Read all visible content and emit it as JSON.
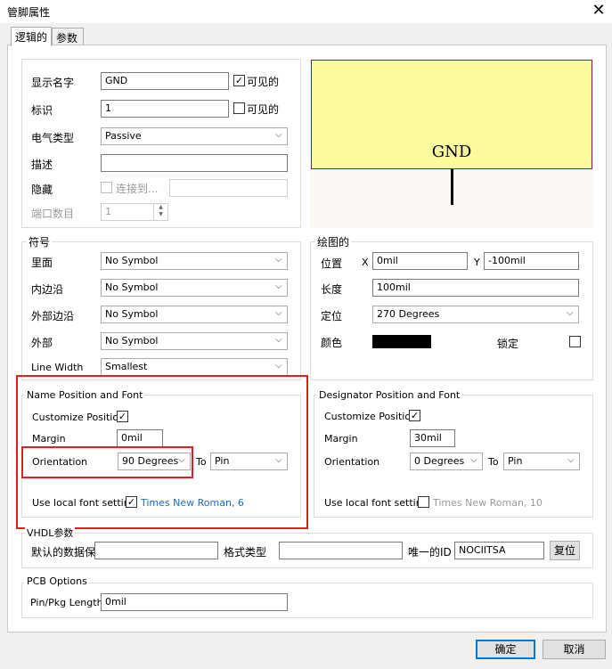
{
  "window": {
    "title": "管脚属性",
    "close_glyph": "✕"
  },
  "tabs": [
    {
      "label": "逻辑的"
    },
    {
      "label": "参数"
    }
  ],
  "basic": {
    "display_name_label": "显示名字",
    "display_name_value": "GND",
    "display_name_visible_label": "可见的",
    "designator_label": "标识",
    "designator_value": "1",
    "designator_visible_label": "可见的",
    "electrical_type_label": "电气类型",
    "electrical_type_value": "Passive",
    "description_label": "描述",
    "description_value": "",
    "hidden_label": "隐藏",
    "connect_to_label": "连接到...",
    "connect_to_value": "",
    "port_count_label": "端口数目",
    "port_count_value": "1"
  },
  "preview": {
    "pin_name": "GND"
  },
  "symbols": {
    "title": "符号",
    "inside_label": "里面",
    "inside_value": "No Symbol",
    "inside_edge_label": "内边沿",
    "inside_edge_value": "No Symbol",
    "outside_edge_label": "外部边沿",
    "outside_edge_value": "No Symbol",
    "outside_label": "外部",
    "outside_value": "No Symbol",
    "line_width_label": "Line Width",
    "line_width_value": "Smallest"
  },
  "graphics": {
    "title": "绘图的",
    "location_label": "位置",
    "x_label": "X",
    "x_value": "0mil",
    "y_label": "Y",
    "y_value": "-100mil",
    "length_label": "长度",
    "length_value": "100mil",
    "orientation_label": "定位",
    "orientation_value": "270 Degrees",
    "color_label": "颜色",
    "color_value": "#000000",
    "lock_label": "锁定"
  },
  "name_font": {
    "title": "Name Position and Font",
    "customize_label": "Customize Position",
    "margin_label": "Margin",
    "margin_value": "0mil",
    "orientation_label": "Orientation",
    "orientation_value": "90 Degrees",
    "to_label": "To",
    "to_value": "Pin",
    "local_font_label": "Use local font setting",
    "font_value": "Times New Roman, 6"
  },
  "designator_font": {
    "title": "Designator Position and Font",
    "customize_label": "Customize Position",
    "margin_label": "Margin",
    "margin_value": "30mil",
    "orientation_label": "Orientation",
    "orientation_value": "0 Degrees",
    "to_label": "To",
    "to_value": "Pin",
    "local_font_label": "Use local font setting",
    "font_value": "Times New Roman, 10"
  },
  "vhdl": {
    "title": "VHDL参数",
    "default_data_label": "默认的数据保",
    "default_data_value": "",
    "format_type_label": "格式类型",
    "format_type_value": "",
    "unique_id_label": "唯一的ID",
    "unique_id_value": "NOCIITSA",
    "reset_label": "复位"
  },
  "pcb": {
    "title": "PCB Options",
    "pin_pkg_length_label": "Pin/Pkg Length",
    "pin_pkg_length_value": "0mil"
  },
  "footer": {
    "ok_label": "确定",
    "cancel_label": "取消"
  },
  "glyphs": {
    "check": "✓",
    "chevron": "⌵",
    "up": "▲",
    "down": "▼"
  },
  "colors": {
    "highlight": "#e02020",
    "preview_fill": "#fbfa9f",
    "font_link": "#1f6cc0"
  }
}
